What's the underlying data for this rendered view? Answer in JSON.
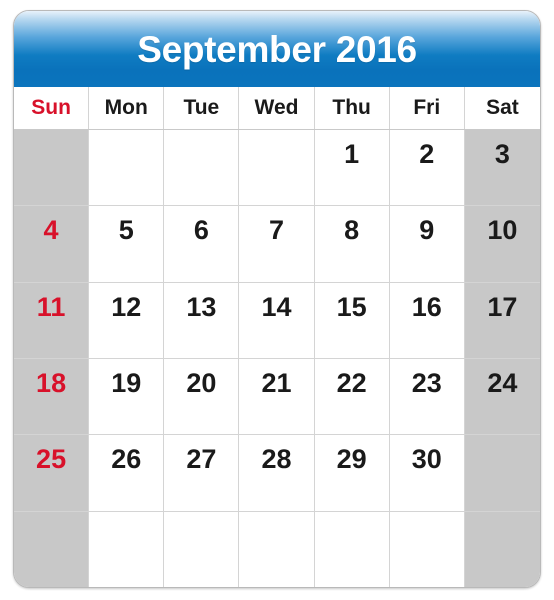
{
  "calendar": {
    "title": "September 2016",
    "month": "September",
    "year": "2016",
    "weekdays": [
      {
        "label": "Sun",
        "is_weekend": true
      },
      {
        "label": "Mon",
        "is_weekend": false
      },
      {
        "label": "Tue",
        "is_weekend": false
      },
      {
        "label": "Wed",
        "is_weekend": false
      },
      {
        "label": "Thu",
        "is_weekend": false
      },
      {
        "label": "Fri",
        "is_weekend": false
      },
      {
        "label": "Sat",
        "is_weekend": true
      }
    ],
    "weeks": [
      [
        "",
        "",
        "",
        "",
        "1",
        "2",
        "3"
      ],
      [
        "4",
        "5",
        "6",
        "7",
        "8",
        "9",
        "10"
      ],
      [
        "11",
        "12",
        "13",
        "14",
        "15",
        "16",
        "17"
      ],
      [
        "18",
        "19",
        "20",
        "21",
        "22",
        "23",
        "24"
      ],
      [
        "25",
        "26",
        "27",
        "28",
        "29",
        "30",
        ""
      ],
      [
        "",
        "",
        "",
        "",
        "",
        "",
        ""
      ]
    ],
    "colors": {
      "header_gradient_top": "#e8f2fb",
      "header_gradient_bottom": "#0b74bd",
      "title_text": "#ffffff",
      "sunday_text": "#d8112a",
      "weekday_text": "#1a1a1a",
      "weekend_cell_background": "#c8c8c8",
      "weekday_cell_background": "#ffffff",
      "grid_line": "#d4d4d4",
      "outer_border": "#b9b9b9",
      "page_background": "#ffffff"
    }
  }
}
